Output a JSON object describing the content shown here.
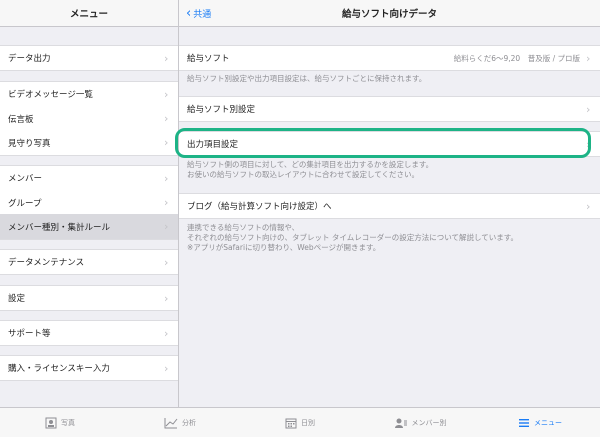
{
  "left": {
    "title": "メニュー",
    "items": [
      {
        "label": "データ出力"
      },
      {
        "label": "ビデオメッセージ一覧"
      },
      {
        "label": "伝言板"
      },
      {
        "label": "見守り写真"
      },
      {
        "label": "メンバー"
      },
      {
        "label": "グループ"
      },
      {
        "label": "メンバー種別・集計ルール",
        "selected": true
      },
      {
        "label": "データメンテナンス"
      },
      {
        "label": "設定"
      },
      {
        "label": "サポート等"
      },
      {
        "label": "購入・ライセンスキー入力"
      }
    ]
  },
  "right": {
    "back_label": "共通",
    "title": "給与ソフト向けデータ",
    "rows": {
      "software": {
        "label": "給与ソフト",
        "value": "給料らくだ6〜9,20　普及版 / プロ版"
      },
      "per_software": {
        "label": "給与ソフト別設定"
      },
      "output": {
        "label": "出力項目設定"
      },
      "blog": {
        "label": "ブログ（給与計算ソフト向け設定）へ"
      }
    },
    "notes": {
      "software_note": "給与ソフト別設定や出力項目設定は、給与ソフトごとに保持されます。",
      "output_note_1": "給与ソフト側の項目に対して、どの集計項目を出力するかを設定します。",
      "output_note_2": "お使いの給与ソフトの取込レイアウトに合わせて設定してください。",
      "blog_note_1": "連携できる給与ソフトの情報や、",
      "blog_note_2": "それぞれの給与ソフト向けの、タブレット タイムレコーダーの設定方法について解説しています。",
      "blog_note_3": "※アプリがSafariに切り替わり、Webページが開きます。"
    }
  },
  "tabbar": {
    "tabs": [
      {
        "label": "写真",
        "icon": "photo-icon"
      },
      {
        "label": "分析",
        "icon": "chart-icon"
      },
      {
        "label": "日別",
        "icon": "calendar-icon"
      },
      {
        "label": "メンバー別",
        "icon": "member-icon"
      },
      {
        "label": "メニュー",
        "icon": "menu-icon",
        "active": true
      }
    ]
  },
  "colors": {
    "accent": "#1a7cf5",
    "highlight": "#1db386",
    "background": "#efeff4"
  }
}
